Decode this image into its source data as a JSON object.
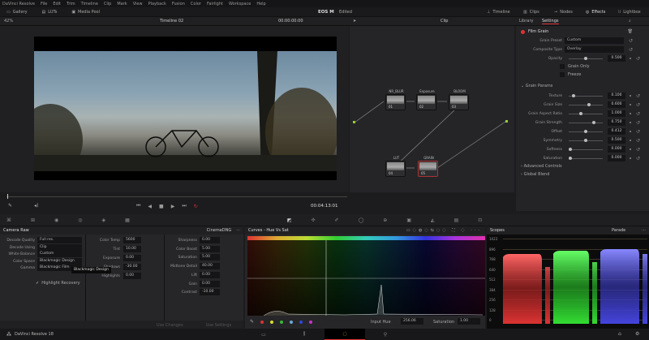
{
  "menu": [
    "DaVinci Resolve",
    "File",
    "Edit",
    "Trim",
    "Timeline",
    "Clip",
    "Mark",
    "View",
    "Playback",
    "Fusion",
    "Color",
    "Fairlight",
    "Workspace",
    "Help"
  ],
  "toolbar": {
    "gallery": "Gallery",
    "luts": "LUTs",
    "media_pool": "Media Pool",
    "project": "EOS M",
    "mode": "Edited",
    "timeline": "Timeline",
    "clips": "Clips",
    "nodes": "Nodes",
    "effects": "Effects",
    "lightbox": "Lightbox"
  },
  "viewer": {
    "zoom": "42%",
    "timeline_name": "Timeline 02",
    "timecode_in": "00:00:00:00",
    "timecode": "00:04:13:01"
  },
  "node_graph": {
    "mode": "Clip",
    "nodes": [
      {
        "label": "NR_BLUR",
        "num": "01"
      },
      {
        "label": "Exposure",
        "num": "02"
      },
      {
        "label": "BLOOM",
        "num": "03"
      },
      {
        "label": "LUT",
        "num": "04"
      },
      {
        "label": "GRAIN",
        "num": "05"
      }
    ]
  },
  "settings": {
    "tabs": [
      "Library",
      "Settings"
    ],
    "active_tab": "Settings",
    "effect": "Film Grain",
    "grain_preset_label": "Grain Preset",
    "grain_preset": "Custom",
    "composite_label": "Composite Type",
    "composite": "Overlay",
    "opacity_label": "Opacity",
    "opacity": "0.500",
    "grain_only": "Grain Only",
    "freeze": "Freeze",
    "grain_params": "Grain Params",
    "params": [
      {
        "label": "Texture",
        "value": "0.100",
        "pos": 0.1
      },
      {
        "label": "Grain Size",
        "value": "0.600",
        "pos": 0.6
      },
      {
        "label": "Grain Aspect Ratio",
        "value": "1.000",
        "pos": 0.35
      },
      {
        "label": "Grain Strength",
        "value": "0.750",
        "pos": 0.75
      },
      {
        "label": "Offset",
        "value": "0.412",
        "pos": 0.5
      },
      {
        "label": "Symmetry",
        "value": "0.500",
        "pos": 0.5
      },
      {
        "label": "Softness",
        "value": "0.000",
        "pos": 0
      },
      {
        "label": "Saturation",
        "value": "0.000",
        "pos": 0
      }
    ],
    "advanced": "Advanced Controls",
    "global_blend": "Global Blend"
  },
  "camera_raw": {
    "title": "Camera Raw",
    "format": "CinemaDNG",
    "left": [
      {
        "label": "Decode Quality",
        "value": "Full res."
      },
      {
        "label": "Decode Using",
        "value": "Clip"
      },
      {
        "label": "White Balance",
        "value": "Custom"
      },
      {
        "label": "Color Space",
        "value": "Blackmagic Design"
      },
      {
        "label": "Gamma",
        "value": "Blackmagic Film"
      }
    ],
    "tooltip": "Blackmagic Design",
    "highlight_recovery": "Highlight Recovery",
    "mid": [
      {
        "label": "Color Temp",
        "value": "5600"
      },
      {
        "label": "Tint",
        "value": "10.00"
      },
      {
        "label": "Exposure",
        "value": "0.00"
      },
      {
        "label": "Shadows",
        "value": "-30.00"
      },
      {
        "label": "Highlights",
        "value": "0.00"
      }
    ],
    "right": [
      {
        "label": "Sharpness",
        "value": "0.00"
      },
      {
        "label": "Color Boost",
        "value": "5.00"
      },
      {
        "label": "Saturation",
        "value": "5.00"
      },
      {
        "label": "Midtone Detail",
        "value": "40.00"
      },
      {
        "label": "Lift",
        "value": "0.00"
      },
      {
        "label": "Gain",
        "value": "0.00"
      },
      {
        "label": "Contrast",
        "value": "-10.00"
      }
    ],
    "use_changes": "Use Changes",
    "use_settings": "Use Settings"
  },
  "curves": {
    "title": "Curves - Hue Vs Sat",
    "input_hue_label": "Input Hue",
    "input_hue": "256.06",
    "saturation_label": "Saturation",
    "saturation": "1.00",
    "swatches": [
      "#d33",
      "#dd3",
      "#3b3",
      "#6ad",
      "#34d",
      "#c3c"
    ]
  },
  "scopes": {
    "title": "Scopes",
    "mode": "Parade",
    "ticks": [
      "1023",
      "896",
      "768",
      "640",
      "512",
      "384",
      "256",
      "128",
      "0"
    ]
  },
  "status": {
    "app": "DaVinci Resolve 18"
  }
}
